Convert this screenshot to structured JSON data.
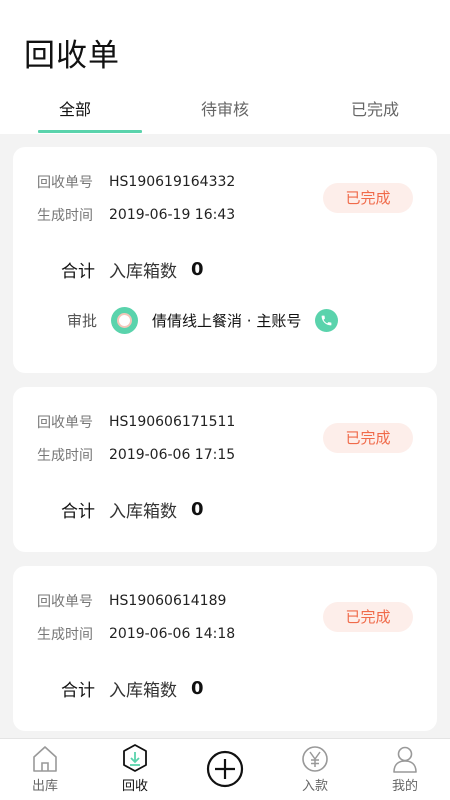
{
  "page": {
    "title": "回收单"
  },
  "tabs": [
    {
      "label": "全部",
      "active": true
    },
    {
      "label": "待审核",
      "active": false
    },
    {
      "label": "已完成",
      "active": false
    }
  ],
  "labels": {
    "order_no": "回收单号",
    "created_time": "生成时间",
    "total": "合计",
    "box_count": "入库箱数",
    "approve": "审批"
  },
  "cards": [
    {
      "order_no": "HS190619164332",
      "created_time": "2019-06-19 16:43",
      "status": "已完成",
      "box_count": "0",
      "approver": {
        "name": "倩倩线上餐消 · 主账号"
      }
    },
    {
      "order_no": "HS190606171511",
      "created_time": "2019-06-06 17:15",
      "status": "已完成",
      "box_count": "0"
    },
    {
      "order_no": "HS19060614189",
      "created_time": "2019-06-06 14:18",
      "status": "已完成",
      "box_count": "0"
    }
  ],
  "tabbar": [
    {
      "label": "出库",
      "icon": "house-icon",
      "active": false
    },
    {
      "label": "回收",
      "icon": "recycle-icon",
      "active": true
    },
    {
      "label": "",
      "icon": "plus-circle-icon",
      "active": false
    },
    {
      "label": "入款",
      "icon": "yen-icon",
      "active": false
    },
    {
      "label": "我的",
      "icon": "person-icon",
      "active": false
    }
  ],
  "colors": {
    "accent": "#5ad3ac",
    "status_text": "#f06a4a",
    "status_bg": "#fdeeea"
  }
}
